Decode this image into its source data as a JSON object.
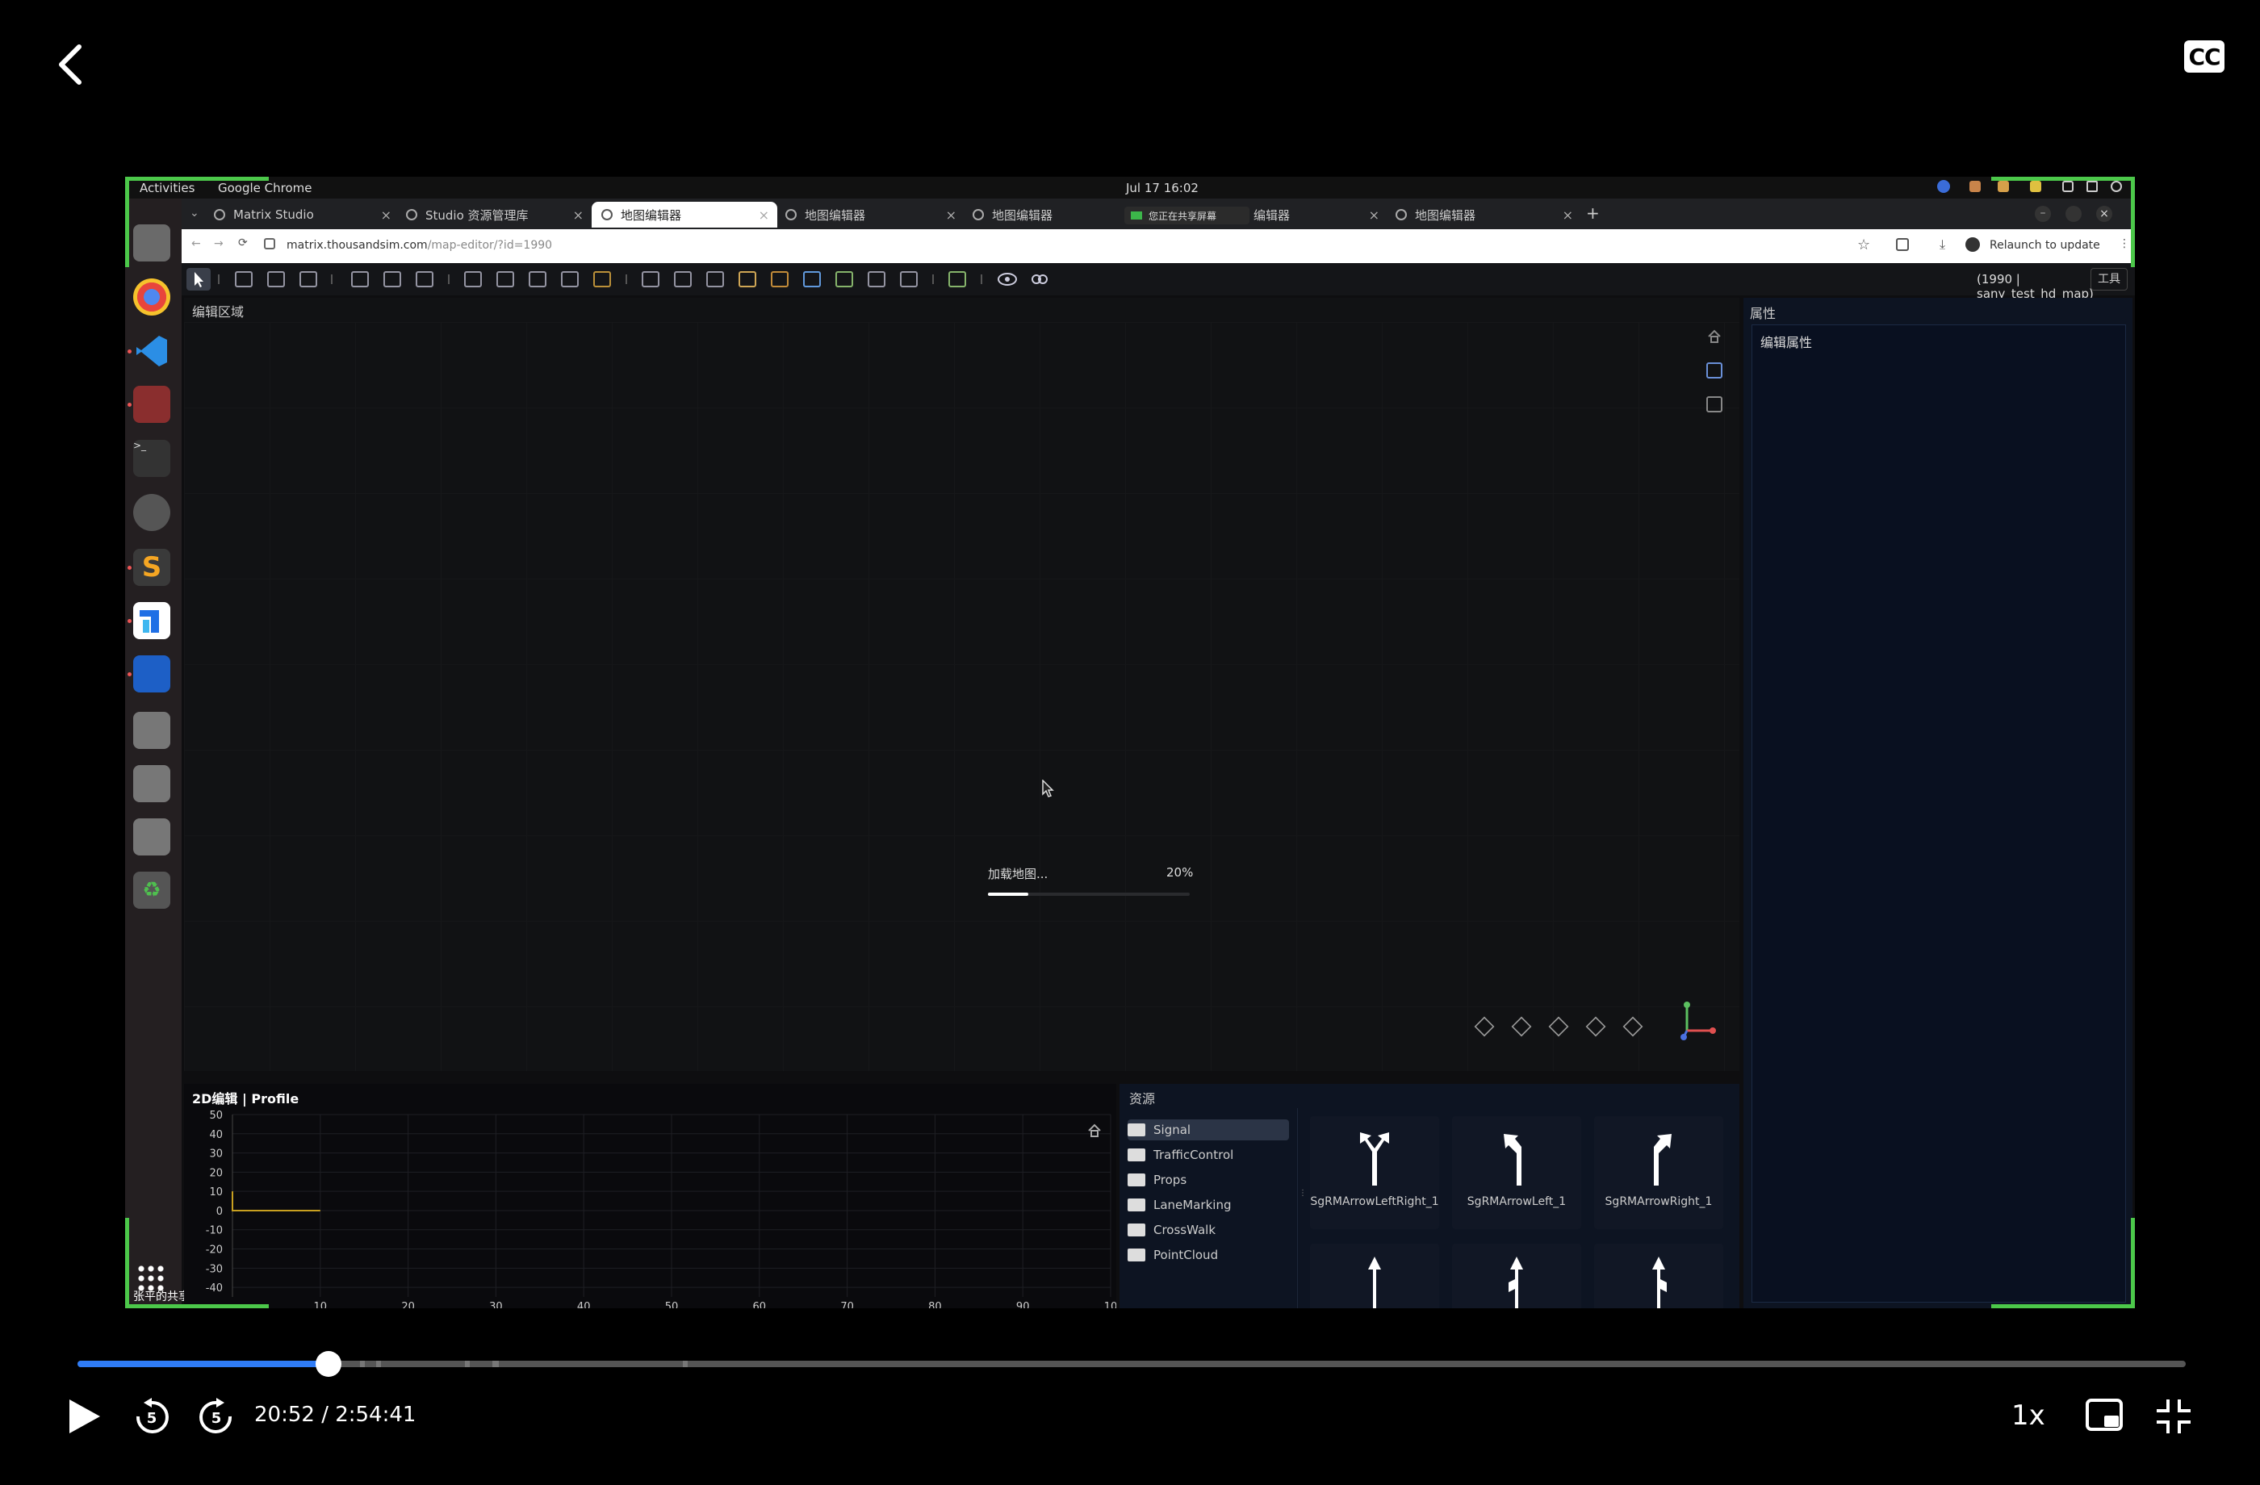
{
  "player": {
    "cc_label": "CC",
    "time_current": "20:52",
    "time_total": "2:54:41",
    "time_text": "20:52 / 2:54:41",
    "speed": "1x",
    "progress_fraction": 0.119
  },
  "os": {
    "activities": "Activities",
    "app_name": "Google Chrome",
    "clock": "Jul 17  16:02",
    "sharing_label": "张平的共享屏幕"
  },
  "browser": {
    "tabs": [
      {
        "label": "Matrix Studio",
        "active": false
      },
      {
        "label": "Studio 资源管理库",
        "active": false
      },
      {
        "label": "地图编辑器",
        "active": true
      },
      {
        "label": "地图编辑器",
        "active": false
      },
      {
        "label": "地图编辑器",
        "active": false
      },
      {
        "label": "编辑器",
        "active": false
      },
      {
        "label": "地图编辑器",
        "active": false
      }
    ],
    "share_badge": "您正在共享屏幕",
    "new_tab": "+",
    "url_domain": "matrix.thousandsim.com",
    "url_path": "/map-editor/?id=1990",
    "relaunch": "Relaunch to update"
  },
  "app": {
    "map_name": "(1990 | sany_test_hd_map)",
    "tools_button": "工具",
    "editor_title": "编辑区域",
    "loading_label": "加载地图...",
    "loading_percent": "20%",
    "loading_fraction": 0.2,
    "props_title": "属性",
    "props_sub": "编辑属性",
    "profile_title": "2D编辑 | Profile",
    "resources_title": "资源",
    "folders": [
      "Signal",
      "TrafficControl",
      "Props",
      "LaneMarking",
      "CrossWalk",
      "PointCloud"
    ],
    "selected_folder": "Signal",
    "assets": [
      "SgRMArrowLeftRight_1",
      "SgRMArrowLeft_1",
      "SgRMArrowRight_1",
      "",
      "",
      ""
    ]
  },
  "chart_data": {
    "type": "line",
    "title": "2D编辑 | Profile",
    "xlabel": "",
    "ylabel": "",
    "x_ticks": [
      10,
      20,
      30,
      40,
      50,
      60,
      70,
      80,
      90,
      10
    ],
    "y_ticks": [
      50,
      40,
      30,
      20,
      10,
      0,
      -10,
      -20,
      -30,
      -40
    ],
    "xlim": [
      0,
      100
    ],
    "ylim": [
      -45,
      50
    ],
    "grid": true,
    "series": [
      {
        "x": [
          0,
          0,
          10
        ],
        "y": [
          10,
          0,
          0
        ],
        "color": "#c8a020"
      }
    ]
  },
  "colors": {
    "accent": "#2f7cf6",
    "share_green": "#4cc84a",
    "profile_line": "#c8a020"
  }
}
